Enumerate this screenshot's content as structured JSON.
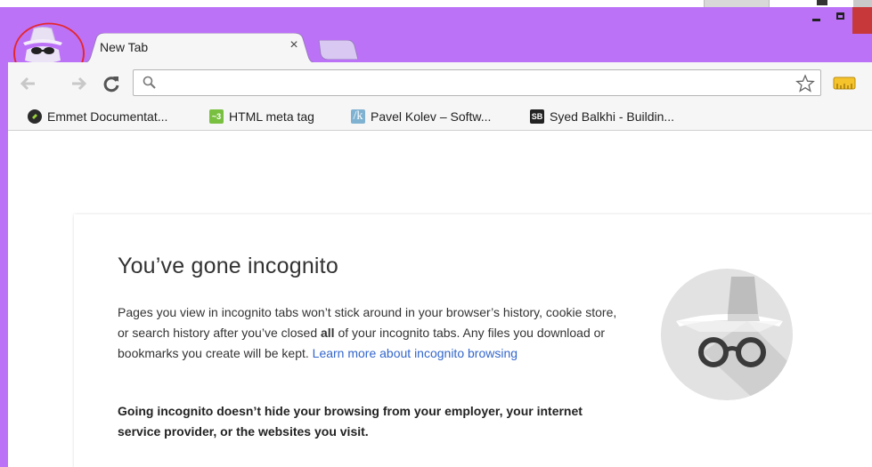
{
  "window": {
    "controls": {
      "minimize": "minimize",
      "maximize": "maximize",
      "close": "close"
    }
  },
  "tab": {
    "title": "New Tab",
    "close_glyph": "×"
  },
  "omnibox": {
    "value": "",
    "placeholder": ""
  },
  "bookmarks": [
    {
      "label": "Emmet Documentat..."
    },
    {
      "label": "HTML meta tag",
      "fav_text": "~3"
    },
    {
      "label": "Pavel Kolev – Softw...",
      "fav_text": "/k"
    },
    {
      "label": "Syed Balkhi - Buildin...",
      "fav_text": "SB"
    }
  ],
  "incognito": {
    "title": "You’ve gone incognito",
    "para_part1": "Pages you view in incognito tabs won’t stick around in your browser’s history, cookie store, or search history after you’ve closed ",
    "para_bold": "all",
    "para_part2": " of your incognito tabs. Any files you download or bookmarks you create will be kept. ",
    "learn_more": "Learn more about incognito browsing",
    "warning": "Going incognito doesn’t hide your browsing from your employer, your internet service provider, or the websites you visit."
  },
  "colors": {
    "frame": "#bc72f7",
    "highlight_circle": "#e5272b",
    "link": "#3366cc"
  },
  "icons": {
    "avatar": "incognito-avatar-icon",
    "back": "back-arrow-icon",
    "forward": "forward-arrow-icon",
    "reload": "reload-icon",
    "search": "search-icon",
    "star": "star-icon",
    "extension": "ruler-extension-icon",
    "illustration": "incognito-spy-icon"
  }
}
